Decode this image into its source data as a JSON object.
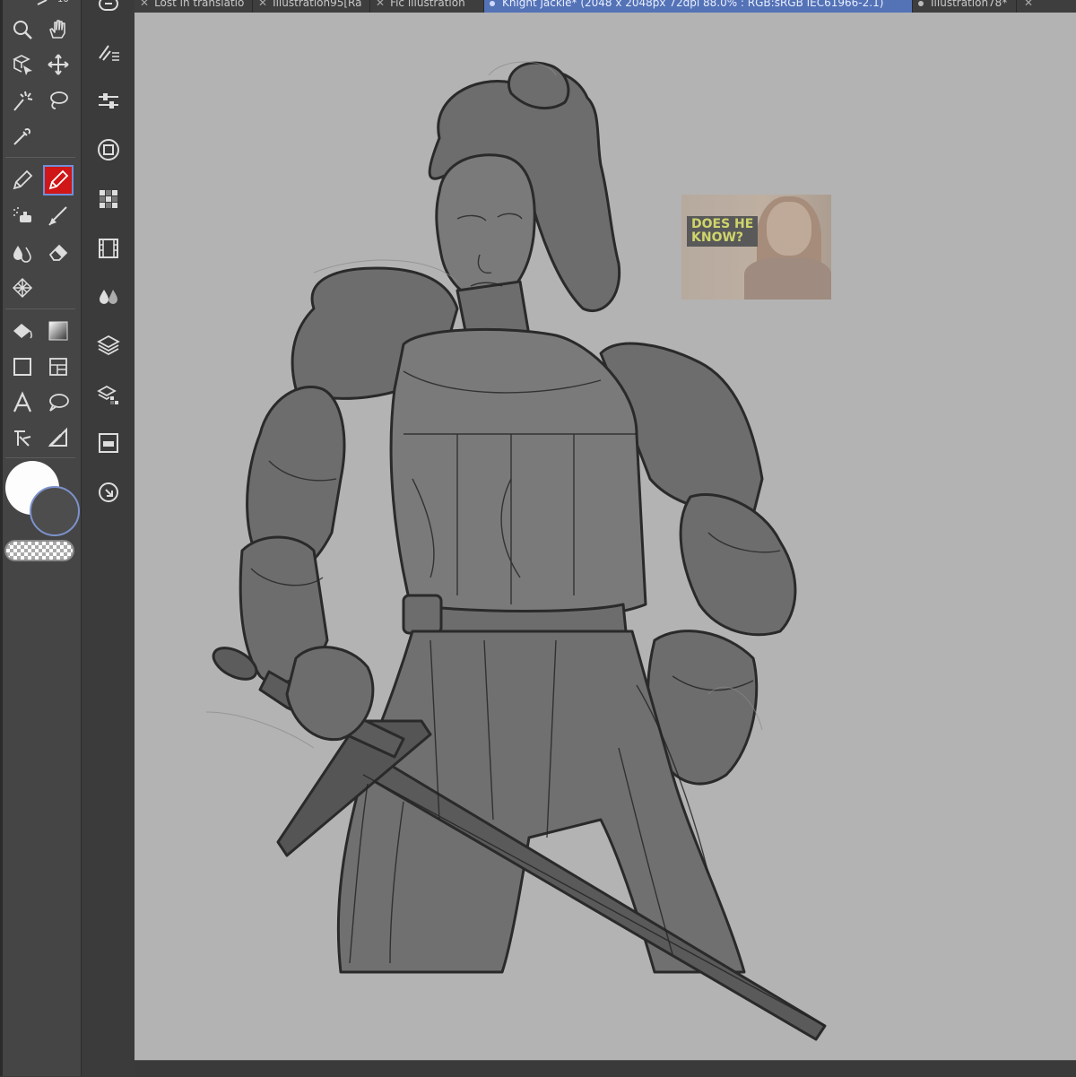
{
  "tabs": [
    {
      "label": "Lost in translatio",
      "active": false
    },
    {
      "label": "Illustration95[Ra",
      "active": false
    },
    {
      "label": "Fic illustration",
      "active": false
    },
    {
      "label": "Knight jackie* (2048 x 2048px 72dpi 88.0% : RGB:sRGB IEC61966-2.1)",
      "active": true
    },
    {
      "label": "Illustration78*",
      "active": false
    }
  ],
  "toolbar": {
    "top_indicator": "10",
    "tools": [
      "zoom-icon",
      "hand-icon",
      "object-select-icon",
      "move-icon",
      "magic-wand-icon",
      "lasso-icon",
      "eyedropper-icon",
      "pen-icon",
      "pencil-icon",
      "airbrush-icon",
      "brush-icon",
      "blend-icon",
      "eraser-icon",
      "decoration-icon",
      "fill-icon",
      "gradient-icon",
      "rectangle-icon",
      "frame-icon",
      "text-icon",
      "balloon-icon",
      "ruler-icon",
      "correct-line-icon"
    ],
    "active_tool": "pencil-icon"
  },
  "subtool": {
    "icons": [
      "sub-tool-icon",
      "brush-size-icon",
      "tool-property-icon",
      "color-wheel-icon",
      "color-set-icon",
      "animation-icon",
      "color-history-icon",
      "layer-icon",
      "layer-property-icon",
      "navigator-icon",
      "search-layer-icon"
    ]
  },
  "colors": {
    "main": "#fdfdfd",
    "sub": "#4d4d4d",
    "canvas_bg": "#b3b3b3",
    "active_tab": "#5472b6"
  },
  "reference_image": {
    "text_line1": "DOES HE",
    "text_line2": "KNOW?"
  }
}
